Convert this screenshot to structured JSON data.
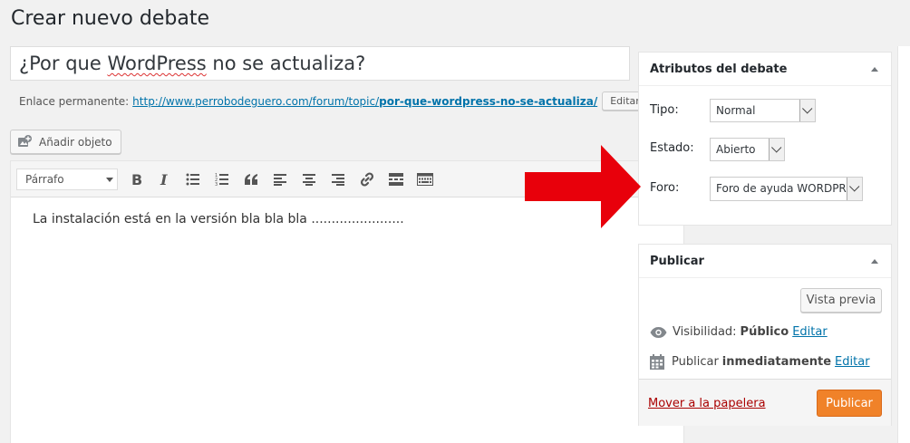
{
  "page": {
    "title": "Crear nuevo debate"
  },
  "post": {
    "title_part1": "¿Por que ",
    "title_part2": "WordPress",
    "title_part3": " no se actualiza?",
    "permalink_label": "Enlace permanente:",
    "permalink_base": "http://www.perrobodeguero.com/forum/topic/",
    "permalink_slug": "por-que-wordpress-no-se-actualiza/",
    "edit_label": "Editar"
  },
  "media": {
    "add_label": "Añadir objeto"
  },
  "editor": {
    "format": "Párrafo",
    "content": "La instalación está en la versión bla bla bla ......................."
  },
  "attributes": {
    "title": "Atributos del debate",
    "type_label": "Tipo:",
    "type_value": "Normal",
    "status_label": "Estado:",
    "status_value": "Abierto",
    "forum_label": "Foro:",
    "forum_value": "Foro de ayuda WORDPRESS"
  },
  "publish": {
    "title": "Publicar",
    "preview_label": "Vista previa",
    "visibility_label": "Visibilidad:",
    "visibility_value": "Público",
    "visibility_edit": "Editar",
    "schedule_label": "Publicar",
    "schedule_value": "inmediatamente",
    "schedule_edit": "Editar",
    "trash_label": "Mover a la papelera",
    "publish_label": "Publicar"
  },
  "colors": {
    "link": "#0073aa",
    "publish_button": "#f08229",
    "trash": "#a00000",
    "annotation_arrow": "#e8000b"
  },
  "icons": [
    "add-media-icon",
    "bold-icon",
    "italic-icon",
    "bullet-list-icon",
    "numbered-list-icon",
    "blockquote-icon",
    "align-left-icon",
    "align-center-icon",
    "align-right-icon",
    "link-icon",
    "read-more-icon",
    "toolbar-toggle-icon",
    "eye-icon",
    "calendar-icon"
  ]
}
